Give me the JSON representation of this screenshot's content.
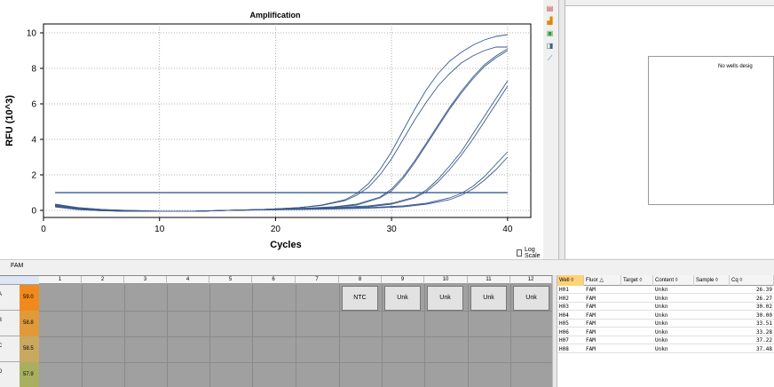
{
  "chart": {
    "title": "Amplification",
    "xlabel": "Cycles",
    "ylabel": "RFU (10^3)",
    "log_scale_label": "Log Scale"
  },
  "chart_data": {
    "type": "line",
    "title": "Amplification",
    "xlabel": "Cycles",
    "ylabel": "RFU (10^3)",
    "xlim": [
      0,
      42
    ],
    "ylim": [
      -0.4,
      10.5
    ],
    "xticks": [
      0,
      10,
      20,
      30,
      40
    ],
    "yticks": [
      0,
      2,
      4,
      6,
      8,
      10
    ],
    "threshold": 1.0,
    "grid": true,
    "series": [
      {
        "well": "H01",
        "x": [
          1,
          3,
          5,
          7,
          10,
          13,
          16,
          19,
          22,
          24,
          26,
          27,
          28,
          29,
          30,
          31,
          32,
          33,
          34,
          35,
          36,
          37,
          38,
          39,
          40
        ],
        "y": [
          0.3,
          0.15,
          0.05,
          0,
          -0.05,
          -0.05,
          0,
          0.05,
          0.15,
          0.3,
          0.6,
          0.95,
          1.5,
          2.3,
          3.3,
          4.5,
          5.7,
          6.8,
          7.7,
          8.4,
          8.9,
          9.3,
          9.6,
          9.8,
          9.9
        ]
      },
      {
        "well": "H02",
        "x": [
          1,
          3,
          5,
          7,
          10,
          13,
          16,
          19,
          22,
          24,
          26,
          27,
          28,
          29,
          30,
          31,
          32,
          33,
          34,
          35,
          36,
          37,
          38,
          39,
          40
        ],
        "y": [
          0.35,
          0.15,
          0.05,
          0,
          -0.05,
          -0.05,
          0,
          0.05,
          0.15,
          0.28,
          0.55,
          0.85,
          1.3,
          2.0,
          2.9,
          4.0,
          5.1,
          6.1,
          7.0,
          7.7,
          8.3,
          8.7,
          9.0,
          9.2,
          9.2
        ]
      },
      {
        "well": "H03",
        "x": [
          1,
          3,
          5,
          7,
          10,
          13,
          16,
          19,
          22,
          25,
          27,
          29,
          30,
          31,
          32,
          33,
          34,
          35,
          36,
          37,
          38,
          39,
          40
        ],
        "y": [
          0.3,
          0.1,
          0,
          -0.05,
          -0.05,
          -0.05,
          0,
          0.05,
          0.1,
          0.2,
          0.35,
          0.75,
          1.2,
          1.9,
          2.8,
          3.8,
          4.8,
          5.8,
          6.7,
          7.5,
          8.2,
          8.7,
          9.1
        ]
      },
      {
        "well": "H04",
        "x": [
          1,
          3,
          5,
          7,
          10,
          13,
          16,
          19,
          22,
          25,
          27,
          29,
          30,
          31,
          32,
          33,
          34,
          35,
          36,
          37,
          38,
          39,
          40
        ],
        "y": [
          0.25,
          0.1,
          0,
          -0.05,
          -0.05,
          -0.05,
          0,
          0.05,
          0.1,
          0.18,
          0.3,
          0.7,
          1.1,
          1.8,
          2.7,
          3.7,
          4.7,
          5.7,
          6.6,
          7.4,
          8.1,
          8.6,
          9.0
        ]
      },
      {
        "well": "H05",
        "x": [
          1,
          3,
          5,
          7,
          10,
          13,
          16,
          19,
          22,
          25,
          28,
          30,
          32,
          33,
          34,
          35,
          36,
          37,
          38,
          39,
          40
        ],
        "y": [
          0.3,
          0.1,
          0,
          -0.05,
          -0.05,
          -0.05,
          0,
          0.05,
          0.1,
          0.15,
          0.25,
          0.4,
          0.75,
          1.15,
          1.75,
          2.5,
          3.3,
          4.3,
          5.3,
          6.3,
          7.3
        ]
      },
      {
        "well": "H06",
        "x": [
          1,
          3,
          5,
          7,
          10,
          13,
          16,
          19,
          22,
          25,
          28,
          30,
          32,
          33,
          34,
          35,
          36,
          37,
          38,
          39,
          40
        ],
        "y": [
          0.25,
          0.08,
          0,
          -0.05,
          -0.05,
          -0.05,
          0,
          0.04,
          0.08,
          0.12,
          0.2,
          0.35,
          0.7,
          1.05,
          1.6,
          2.3,
          3.1,
          4.0,
          5.0,
          6.0,
          7.0
        ]
      },
      {
        "well": "H07",
        "x": [
          1,
          3,
          5,
          7,
          10,
          13,
          16,
          19,
          22,
          25,
          28,
          31,
          33,
          35,
          36,
          37,
          38,
          39,
          40
        ],
        "y": [
          0.2,
          0.05,
          -0.02,
          -0.05,
          -0.05,
          -0.05,
          0,
          0.03,
          0.06,
          0.1,
          0.15,
          0.25,
          0.4,
          0.7,
          0.95,
          1.35,
          1.9,
          2.6,
          3.3
        ]
      },
      {
        "well": "H08",
        "x": [
          1,
          3,
          5,
          7,
          10,
          13,
          16,
          19,
          22,
          25,
          28,
          31,
          33,
          35,
          36,
          37,
          38,
          39,
          40
        ],
        "y": [
          0.2,
          0.05,
          -0.02,
          -0.05,
          -0.05,
          -0.05,
          0,
          0.03,
          0.05,
          0.08,
          0.12,
          0.2,
          0.35,
          0.6,
          0.85,
          1.2,
          1.7,
          2.3,
          3.0
        ]
      }
    ]
  },
  "toolbar": {
    "icons": [
      "graph-settings-icon",
      "bar-chart-icon",
      "image-export-icon",
      "copy-chart-icon",
      "line-style-icon"
    ]
  },
  "right_panel": {
    "message": "No wells desig"
  },
  "fluor_bar": {
    "label": "FAM"
  },
  "plate": {
    "columns": [
      "1",
      "2",
      "3",
      "4",
      "5",
      "6",
      "7",
      "8",
      "9",
      "10",
      "11",
      "12"
    ],
    "rows": [
      {
        "letter": "A",
        "temp": "59.0",
        "temp_color": "#f08a1c"
      },
      {
        "letter": "B",
        "temp": "58.8",
        "temp_color": "#e09a3a"
      },
      {
        "letter": "C",
        "temp": "58.5",
        "temp_color": "#c9a860"
      },
      {
        "letter": "D",
        "temp": "57.9",
        "temp_color": "#a8b060"
      }
    ],
    "wells_row_a": [
      {
        "col": "8",
        "label": "NTC"
      },
      {
        "col": "9",
        "label": "Unk"
      },
      {
        "col": "10",
        "label": "Unk"
      },
      {
        "col": "11",
        "label": "Unk"
      },
      {
        "col": "12",
        "label": "Unk"
      }
    ]
  },
  "table": {
    "headers": [
      "Well",
      "Fluor",
      "Target",
      "Content",
      "Sample",
      "Cq"
    ],
    "sort_glyphs": [
      "◊",
      "△",
      "◊",
      "◊",
      "◊",
      "◊"
    ],
    "rows": [
      {
        "well": "H01",
        "fluor": "FAM",
        "target": "",
        "content": "Unkn",
        "sample": "",
        "cq": "26.39"
      },
      {
        "well": "H02",
        "fluor": "FAM",
        "target": "",
        "content": "Unkn",
        "sample": "",
        "cq": "26.27"
      },
      {
        "well": "H03",
        "fluor": "FAM",
        "target": "",
        "content": "Unkn",
        "sample": "",
        "cq": "30.02"
      },
      {
        "well": "H04",
        "fluor": "FAM",
        "target": "",
        "content": "Unkn",
        "sample": "",
        "cq": "30.00"
      },
      {
        "well": "H05",
        "fluor": "FAM",
        "target": "",
        "content": "Unkn",
        "sample": "",
        "cq": "33.51"
      },
      {
        "well": "H06",
        "fluor": "FAM",
        "target": "",
        "content": "Unkn",
        "sample": "",
        "cq": "33.28"
      },
      {
        "well": "H07",
        "fluor": "FAM",
        "target": "",
        "content": "Unkn",
        "sample": "",
        "cq": "37.22"
      },
      {
        "well": "H08",
        "fluor": "FAM",
        "target": "",
        "content": "Unkn",
        "sample": "",
        "cq": "37.48"
      }
    ]
  },
  "colors": {
    "curve": "#3a5a8c",
    "threshold": "#1f4e8c",
    "selected_header": "#ffd27a"
  }
}
